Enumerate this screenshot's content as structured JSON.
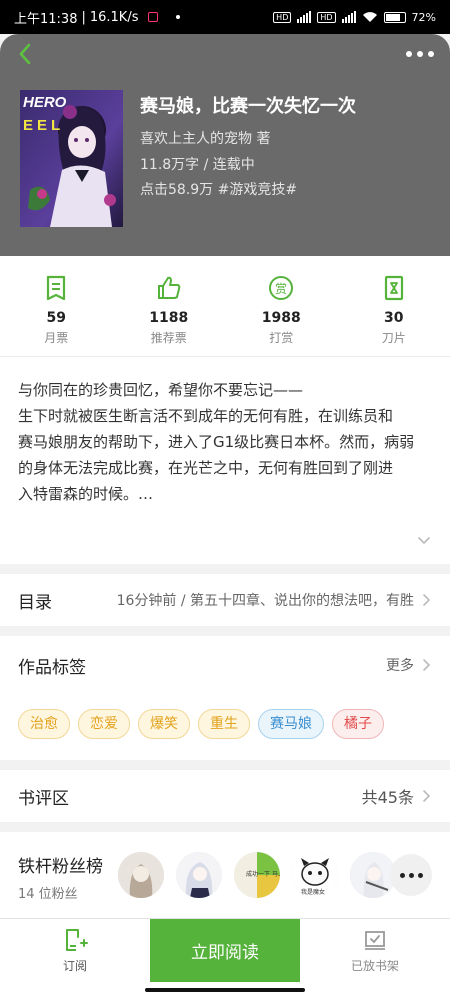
{
  "status_bar": {
    "time": "上午11:38",
    "net_speed": "16.1K/s",
    "battery": "72%"
  },
  "book": {
    "title": "赛马娘，比赛一次失忆一次",
    "author_line": "喜欢上主人的宠物 著",
    "meta_line": "11.8万字 / 连载中",
    "stats_line": "点击58.9万 #游戏竞技#",
    "cover_text_1": "HERO",
    "cover_text_2": "EEL"
  },
  "stats": [
    {
      "value": "59",
      "label": "月票",
      "icon": "ticket-icon"
    },
    {
      "value": "1188",
      "label": "推荐票",
      "icon": "thumbs-up-icon"
    },
    {
      "value": "1988",
      "label": "打赏",
      "icon": "reward-icon"
    },
    {
      "value": "30",
      "label": "刀片",
      "icon": "blade-icon"
    }
  ],
  "description": {
    "lines": [
      "与你同在的珍贵回忆，希望你不要忘记——",
      "生下时就被医生断言活不到成年的无何有胜，在训练员和",
      "赛马娘朋友的帮助下，进入了G1级比赛日本杯。然而，病弱",
      "的身体无法完成比赛，在光芒之中，无何有胜回到了刚进",
      "入特雷森的时候。…"
    ]
  },
  "toc": {
    "title": "目录",
    "latest": "16分钟前 / 第五十四章、说出你的想法吧，有胜"
  },
  "tags": {
    "title": "作品标签",
    "more": "更多",
    "items": [
      {
        "label": "治愈",
        "style": "y"
      },
      {
        "label": "恋爱",
        "style": "y"
      },
      {
        "label": "爆笑",
        "style": "y"
      },
      {
        "label": "重生",
        "style": "y"
      },
      {
        "label": "赛马娘",
        "style": "b"
      },
      {
        "label": "橘子",
        "style": "r"
      }
    ]
  },
  "reviews": {
    "title": "书评区",
    "count": "共45条"
  },
  "fans": {
    "title": "铁杆粉丝榜",
    "count": "14 位粉丝",
    "avatar_texts": [
      "成功一下 马上到家",
      "我是魔女"
    ]
  },
  "bottom_bar": {
    "subscribe": "订阅",
    "read_now": "立即阅读",
    "shelved": "已放书架"
  },
  "colors": {
    "accent": "#55b23b",
    "header_bg": "#6a6a6a"
  }
}
